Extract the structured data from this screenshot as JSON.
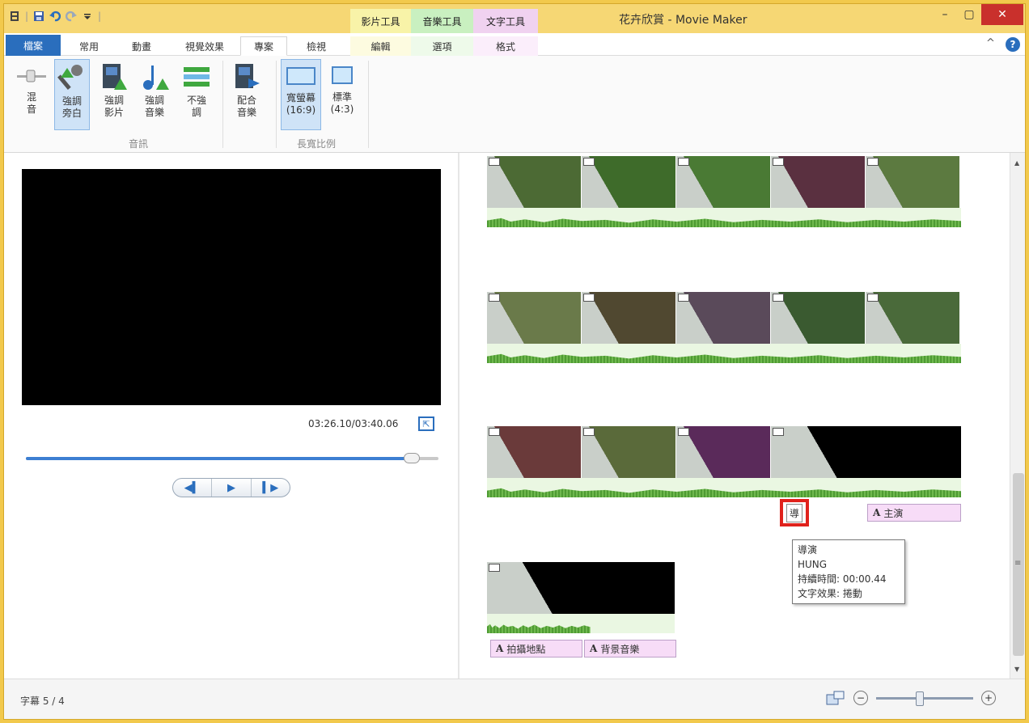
{
  "window": {
    "title": "花卉欣賞 - Movie Maker"
  },
  "context_tabs": {
    "video_tools": "影片工具",
    "music_tools": "音樂工具",
    "text_tools": "文字工具"
  },
  "tabs": [
    "檔案",
    "常用",
    "動畫",
    "視覺效果",
    "專案",
    "檢視",
    "編輯",
    "選項",
    "格式"
  ],
  "ribbon": {
    "audio_group": "音訊",
    "ratio_group": "長寬比例",
    "buttons": {
      "mix": "混\n音",
      "emph_narration": "強調\n旁白",
      "emph_video": "強調\n影片",
      "emph_music": "強調\n音樂",
      "no_emph": "不強\n調",
      "fit_music": "配合\n音樂",
      "widescreen": "寬螢幕\n(16:9)",
      "standard": "標準\n(4:3)"
    }
  },
  "preview": {
    "timecode": "03:26.10/03:40.06",
    "progress": 0.935
  },
  "storyboard": {
    "rows": [
      {
        "thumbs": [
          "#4c6a34",
          "#3e6b2a",
          "#4a7a34",
          "#5a3040",
          "#5c7a40"
        ]
      },
      {
        "thumbs": [
          "#6a7a4a",
          "#504830",
          "#5a4a5a",
          "#3a5a30",
          "#4a6a3a"
        ]
      },
      {
        "thumbs": [
          "#6a3a3a",
          "#5a6a3a",
          "#5a2a5a",
          "#000000"
        ]
      },
      {
        "thumbs": [
          "#000000"
        ]
      }
    ],
    "caption_lead": "主演",
    "caption_location": "拍攝地點",
    "caption_music": "背景音樂",
    "marker_label": "導",
    "tooltip": {
      "line1": "導演",
      "line2": "HUNG",
      "line3": "持續時間: 00:00.44",
      "line4": "文字效果: 捲動"
    }
  },
  "status": {
    "subtitle_count": "字幕 5 / 4",
    "zoom": 0.45
  }
}
